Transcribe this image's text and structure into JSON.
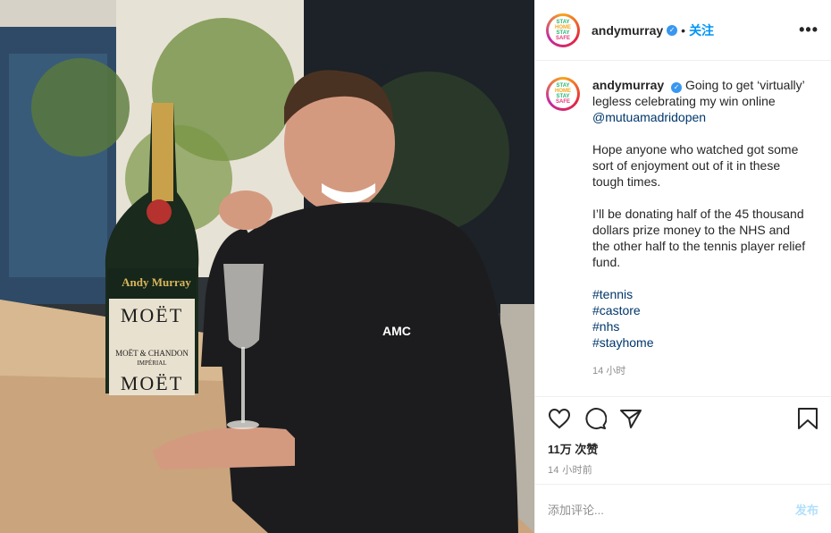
{
  "post": {
    "username": "andymurray",
    "follow_label": "关注",
    "dot": "•",
    "more": "•••",
    "verified_icon": "✓",
    "avatar_lines": [
      "STAY",
      "HOME",
      "STAY",
      "SAFE"
    ],
    "caption_lines": [
      "Going to get ‘virtually’ legless celebrating my win online"
    ],
    "mention": "@mutuamadridopen",
    "paragraph2": "Hope anyone who watched got some sort of enjoyment out of it in these tough times.",
    "paragraph3": "I’ll be donating half of the 45 thousand dollars prize money to the NHS and the other half to the tennis player relief fund.",
    "hashtags": [
      "#tennis",
      "#castore",
      "#nhs",
      "#stayhome"
    ],
    "caption_time": "14 小时",
    "likes": "11万 次赞",
    "post_time": "14 小时前",
    "comment_placeholder": "添加评论...",
    "post_label": "发布"
  },
  "photo": {
    "bottle_label_1": "MOËT",
    "bottle_brand": "Andy Murray",
    "bottle_label_2": "MOËT & CHANDON",
    "bottle_label_3": "IMPÉRIAL",
    "bottle_label_4": "MOËT",
    "hoodie_logo": "AMC"
  },
  "colors": {
    "accent": "#0095f6",
    "link": "#00376b",
    "muted": "#8e8e8e"
  }
}
